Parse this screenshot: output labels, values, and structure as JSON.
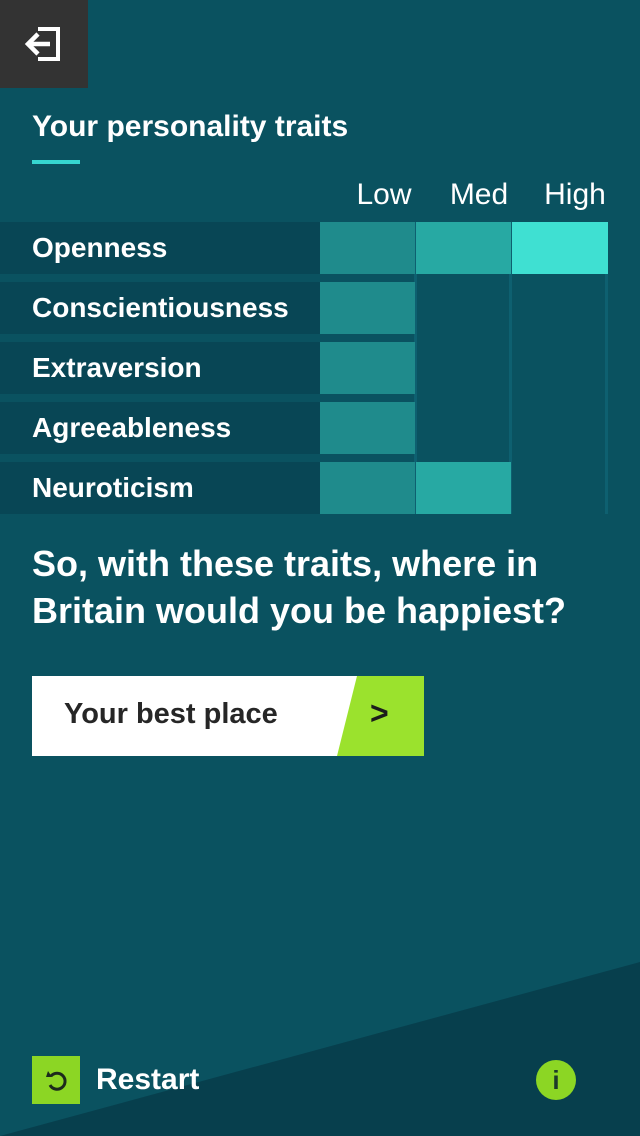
{
  "header": {
    "back_icon": "exit-arrow-icon",
    "title": "Your personality traits"
  },
  "levels": [
    "Low",
    "Med",
    "High"
  ],
  "traits": [
    {
      "name": "Openness",
      "level": 3
    },
    {
      "name": "Conscientiousness",
      "level": 1
    },
    {
      "name": "Extraversion",
      "level": 1
    },
    {
      "name": "Agreeableness",
      "level": 1
    },
    {
      "name": "Neuroticism",
      "level": 2
    }
  ],
  "question": "So, with these traits, where in Britain would you be happiest?",
  "cta": {
    "label": "Your best place",
    "arrow": ">"
  },
  "footer": {
    "restart_label": "Restart",
    "restart_icon": "restart-icon",
    "info_label": "i",
    "info_icon": "info-icon"
  },
  "colors": {
    "background": "#0a5260",
    "accent_green": "#8cd624",
    "accent_teal": "#36d6d0",
    "bar_low": "#1f8b8c",
    "bar_med": "#27a9a3",
    "bar_high": "#3fe0d2"
  }
}
